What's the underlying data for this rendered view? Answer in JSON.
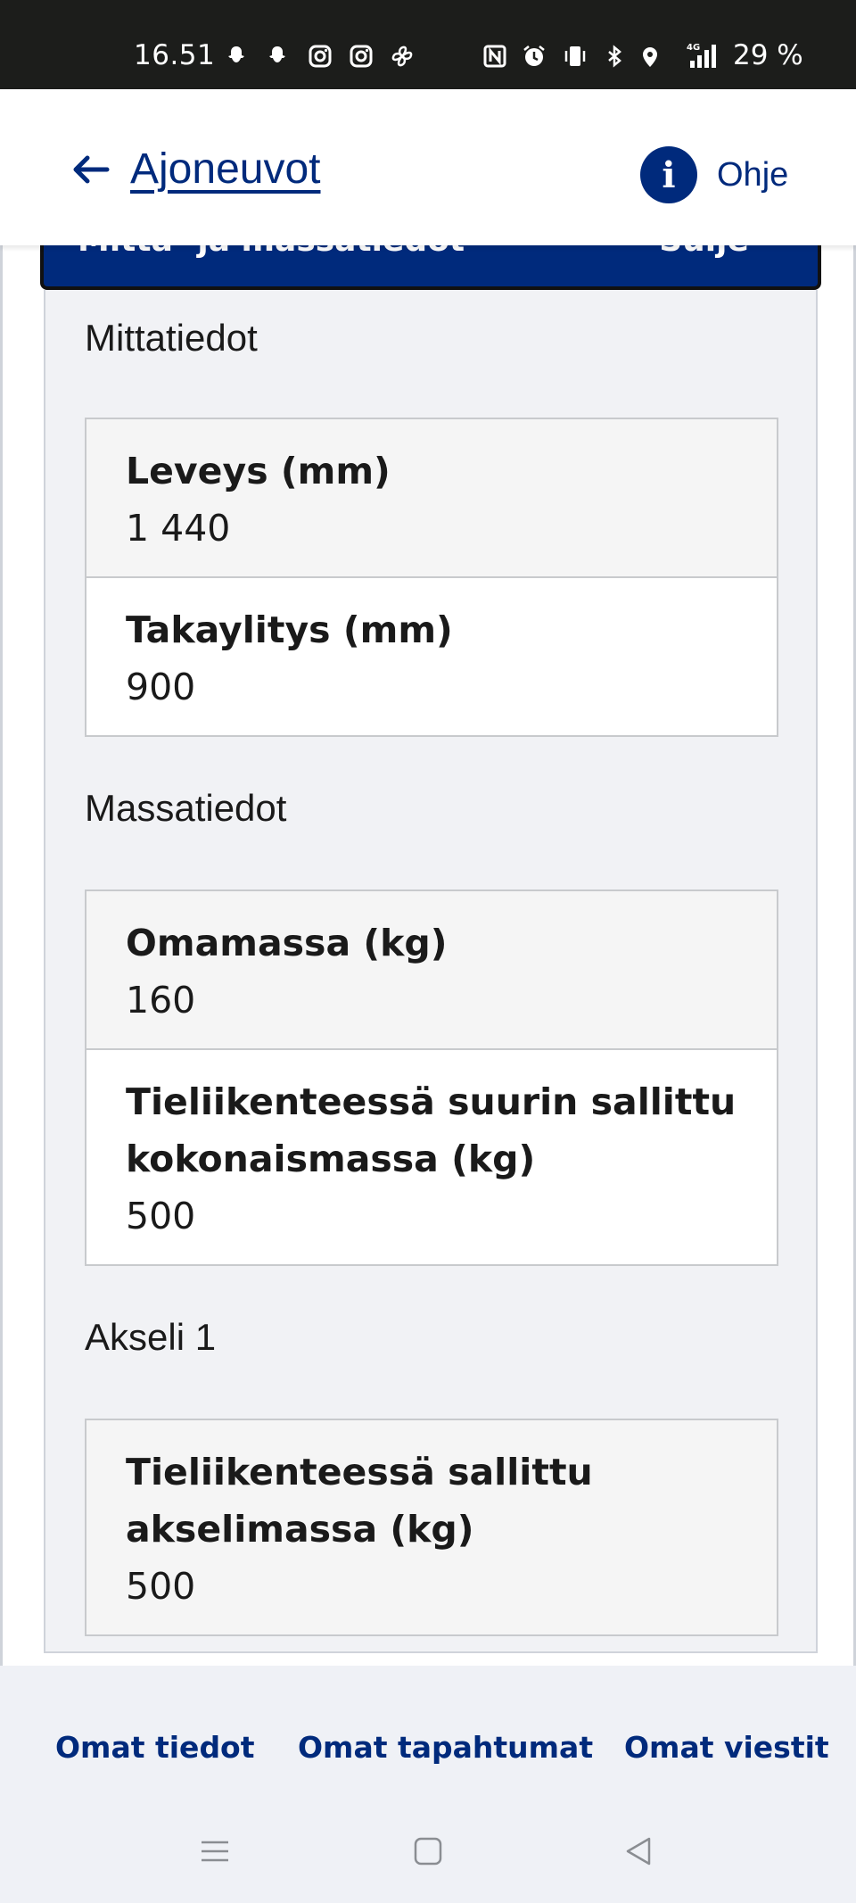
{
  "status_bar": {
    "time": "16.51",
    "battery": "29 %",
    "icons": [
      "snapchat-icon",
      "snapchat-icon",
      "instagram-icon",
      "instagram-icon",
      "fan-icon",
      "nfc-icon",
      "alarm-icon",
      "vibrate-icon",
      "bluetooth-icon",
      "location-icon",
      "signal-4g-icon"
    ]
  },
  "header": {
    "back_label": "Ajoneuvot",
    "help_label": "Ohje",
    "help_icon_glyph": "i"
  },
  "accordion": {
    "title": "Mitta- ja massatiedot",
    "close_label": "Sulje",
    "close_icon_glyph": "⌃"
  },
  "sections": [
    {
      "title": "Mittatiedot",
      "rows": [
        {
          "label": "Leveys (mm)",
          "value": "1 440"
        },
        {
          "label": "Takaylitys (mm)",
          "value": "900"
        }
      ]
    },
    {
      "title": "Massatiedot",
      "rows": [
        {
          "label": "Omamassa (kg)",
          "value": "160"
        },
        {
          "label": "Tieliikenteessä suurin sallittu kokonaismassa (kg)",
          "value": "500"
        }
      ]
    },
    {
      "title": "Akseli 1",
      "rows": [
        {
          "label": "Tieliikenteessä sallittu akselimassa (kg)",
          "value": "500"
        }
      ]
    }
  ],
  "bottom_nav": {
    "items": [
      "Omat tiedot",
      "Omat tapahtumat",
      "Omat viestit"
    ]
  },
  "system_nav": [
    "recents-icon",
    "home-icon",
    "back-icon"
  ],
  "colors": {
    "brand_blue": "#002a7c",
    "status_bar": "#1c1d1b",
    "panel_bg": "#f1f2f5",
    "nav_bg": "#eff1f6"
  }
}
